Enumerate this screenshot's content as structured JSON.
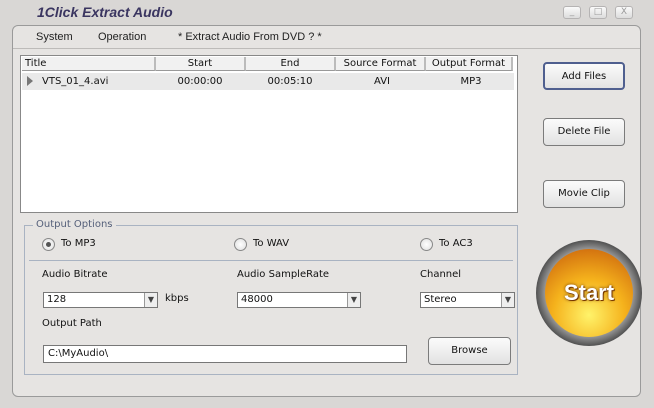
{
  "window": {
    "title": "1Click Extract Audio",
    "controls": [
      "_",
      "□",
      "X"
    ]
  },
  "menu": [
    "System",
    "Operation",
    "* Extract Audio From DVD ? *"
  ],
  "table": {
    "columns": [
      "Title",
      "Start",
      "End",
      "Source Format",
      "Output Format"
    ],
    "rows": [
      [
        "VTS_01_4.avi",
        "00:00:00",
        "00:05:10",
        "AVI",
        "MP3"
      ]
    ]
  },
  "buttons": {
    "add": "Add Files",
    "delete": "Delete File",
    "movie": "Movie Clip",
    "browse": "Browse",
    "start": "Start"
  },
  "options": {
    "group": "Output Options",
    "radios": [
      "To MP3",
      "To WAV",
      "To AC3"
    ],
    "selected": "To MP3",
    "bitrate_label": "Audio Bitrate",
    "bitrate": "128",
    "bitrate_unit": "kbps",
    "samplerate_label": "Audio SampleRate",
    "samplerate": "48000",
    "channel_label": "Channel",
    "channel": "Stereo",
    "path_label": "Output Path",
    "path": "C:\\MyAudio\\"
  }
}
